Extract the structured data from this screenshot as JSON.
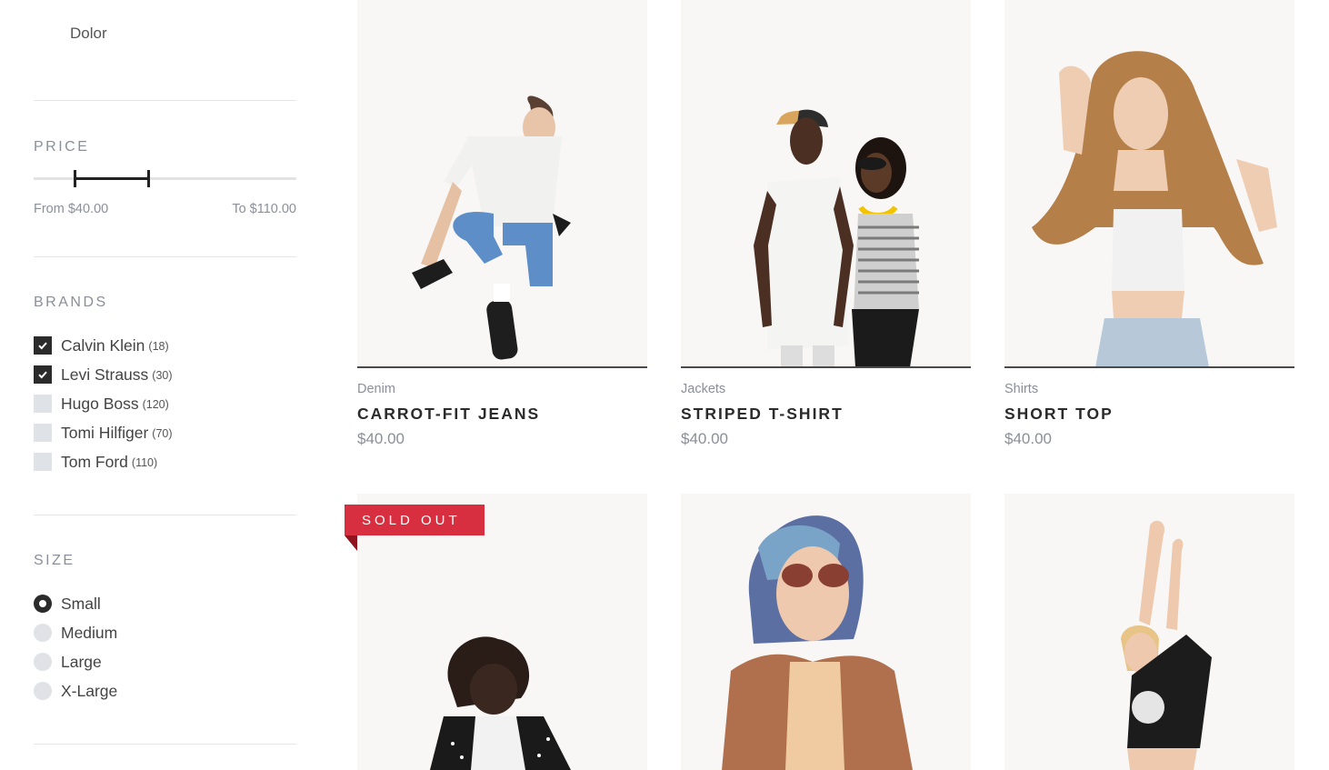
{
  "sidebar": {
    "category_item": "Dolor",
    "price": {
      "title": "PRICE",
      "from": "From $40.00",
      "to": "To $110.00",
      "range_min_value": 40,
      "range_max_value": 110
    },
    "brands": {
      "title": "BRANDS",
      "items": [
        {
          "label": "Calvin Klein",
          "count": "(18)",
          "checked": true
        },
        {
          "label": "Levi Strauss",
          "count": "(30)",
          "checked": true
        },
        {
          "label": "Hugo Boss",
          "count": "(120)",
          "checked": false
        },
        {
          "label": "Tomi Hilfiger",
          "count": "(70)",
          "checked": false
        },
        {
          "label": "Tom Ford",
          "count": "(110)",
          "checked": false
        }
      ]
    },
    "size": {
      "title": "SIZE",
      "items": [
        {
          "label": "Small",
          "selected": true
        },
        {
          "label": "Medium",
          "selected": false
        },
        {
          "label": "Large",
          "selected": false
        },
        {
          "label": "X-Large",
          "selected": false
        }
      ]
    }
  },
  "products": [
    {
      "category": "Denim",
      "name": "CARROT-FIT JEANS",
      "price": "$40.00"
    },
    {
      "category": "Jackets",
      "name": "STRIPED T-SHIRT",
      "price": "$40.00"
    },
    {
      "category": "Shirts",
      "name": "SHORT TOP",
      "price": "$40.00"
    },
    {
      "badge": "SOLD OUT"
    },
    {},
    {}
  ],
  "colors": {
    "accent_dark": "#2b2b2b",
    "muted_text": "#8a8f99",
    "badge_red": "#d72f40",
    "image_bg": "#f8f7f6"
  }
}
